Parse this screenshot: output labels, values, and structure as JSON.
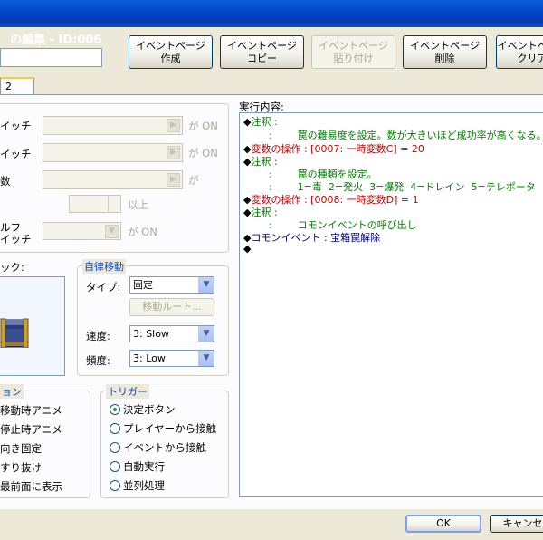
{
  "window": {
    "title": "の編集 - ID:006"
  },
  "toolbar": {
    "event_page_create": "イベントページ\n作成",
    "event_page_copy": "イベントページ\nコピー",
    "event_page_paste": "イベントページ\n貼り付け",
    "event_page_delete": "イベントページ\n削除",
    "event_page_clear": "イベントページ\nクリア"
  },
  "name_field": {
    "value": ""
  },
  "tabs": [
    {
      "label": "2"
    }
  ],
  "conditions": {
    "switch1_label": "イッチ",
    "switch2_label": "イッチ",
    "variable_label": "数",
    "switch_suffix": "が ON",
    "variable_suffix": "が",
    "threshold_suffix": "以上",
    "self_switch_label_1": "ルフ",
    "self_switch_label_2": "イッチ",
    "self_switch_suffix": "が ON"
  },
  "graphic": {
    "label": "ック:"
  },
  "autonomous_movement": {
    "title": "自律移動",
    "type_label": "タイプ:",
    "type_value": "固定",
    "route_button": "移動ルート...",
    "speed_label": "速度:",
    "speed_value": "3: Slow",
    "freq_label": "頻度:",
    "freq_value": "3: Low"
  },
  "options": {
    "title": "ョン",
    "items": [
      "移動時アニメ",
      "停止時アニメ",
      "向き固定",
      "すり抜け",
      "最前面に表示"
    ]
  },
  "trigger": {
    "title": "トリガー",
    "items": [
      "決定ボタン",
      "プレイヤーから接触",
      "イベントから接触",
      "自動実行",
      "並列処理"
    ],
    "selected_index": 0
  },
  "contents": {
    "label": "実行内容:",
    "lines": [
      {
        "bullet": "◆",
        "text": "注釈 :",
        "color": "#008000"
      },
      {
        "bullet": "",
        "text": "        :        罠の難易度を設定。数が大きいほど成功率が高くなる。",
        "color": "#008000"
      },
      {
        "bullet": "◆",
        "text": "変数の操作 : [0007: 一時変数C] = 20",
        "color": "#d00000"
      },
      {
        "bullet": "◆",
        "text": "注釈 :",
        "color": "#008000"
      },
      {
        "bullet": "",
        "text": "        :        罠の種類を設定。",
        "color": "#008000"
      },
      {
        "bullet": "",
        "text": "        :        1=毒  2=発火  3=爆発  4=ドレイン  5=テレポータ",
        "color": "#008000"
      },
      {
        "bullet": "◆",
        "text": "変数の操作 : [0008: 一時変数D] = 1",
        "color": "#d00000"
      },
      {
        "bullet": "◆",
        "text": "注釈 :",
        "color": "#008000"
      },
      {
        "bullet": "",
        "text": "        :        コモンイベントの呼び出し",
        "color": "#008000"
      },
      {
        "bullet": "◆",
        "text": "コモンイベント : 宝箱罠解除",
        "color": "#000080"
      },
      {
        "bullet": "◆",
        "text": "",
        "color": "#000000"
      }
    ]
  },
  "footer": {
    "ok": "OK",
    "cancel": "キャンセル"
  }
}
